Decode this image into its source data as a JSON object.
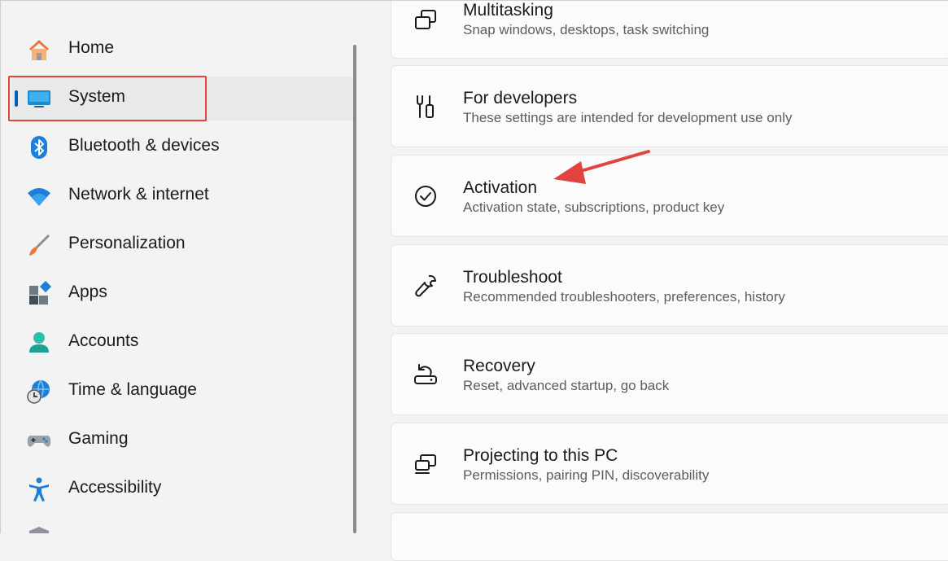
{
  "sidebar": {
    "items": [
      {
        "label": "Home",
        "icon": "home-icon"
      },
      {
        "label": "System",
        "icon": "system-icon",
        "selected": true
      },
      {
        "label": "Bluetooth & devices",
        "icon": "bluetooth-icon"
      },
      {
        "label": "Network & internet",
        "icon": "wifi-icon"
      },
      {
        "label": "Personalization",
        "icon": "brush-icon"
      },
      {
        "label": "Apps",
        "icon": "apps-icon"
      },
      {
        "label": "Accounts",
        "icon": "account-icon"
      },
      {
        "label": "Time & language",
        "icon": "globe-clock-icon"
      },
      {
        "label": "Gaming",
        "icon": "gamepad-icon"
      },
      {
        "label": "Accessibility",
        "icon": "accessibility-icon"
      }
    ]
  },
  "cards": [
    {
      "title": "Multitasking",
      "desc": "Snap windows, desktops, task switching",
      "icon": "multitasking-icon"
    },
    {
      "title": "For developers",
      "desc": "These settings are intended for development use only",
      "icon": "developer-tools-icon"
    },
    {
      "title": "Activation",
      "desc": "Activation state, subscriptions, product key",
      "icon": "check-circle-icon"
    },
    {
      "title": "Troubleshoot",
      "desc": "Recommended troubleshooters, preferences, history",
      "icon": "wrench-icon"
    },
    {
      "title": "Recovery",
      "desc": "Reset, advanced startup, go back",
      "icon": "recovery-icon"
    },
    {
      "title": "Projecting to this PC",
      "desc": "Permissions, pairing PIN, discoverability",
      "icon": "projecting-icon"
    }
  ],
  "colors": {
    "accent": "#005fb8",
    "annotation": "#e0443e"
  }
}
